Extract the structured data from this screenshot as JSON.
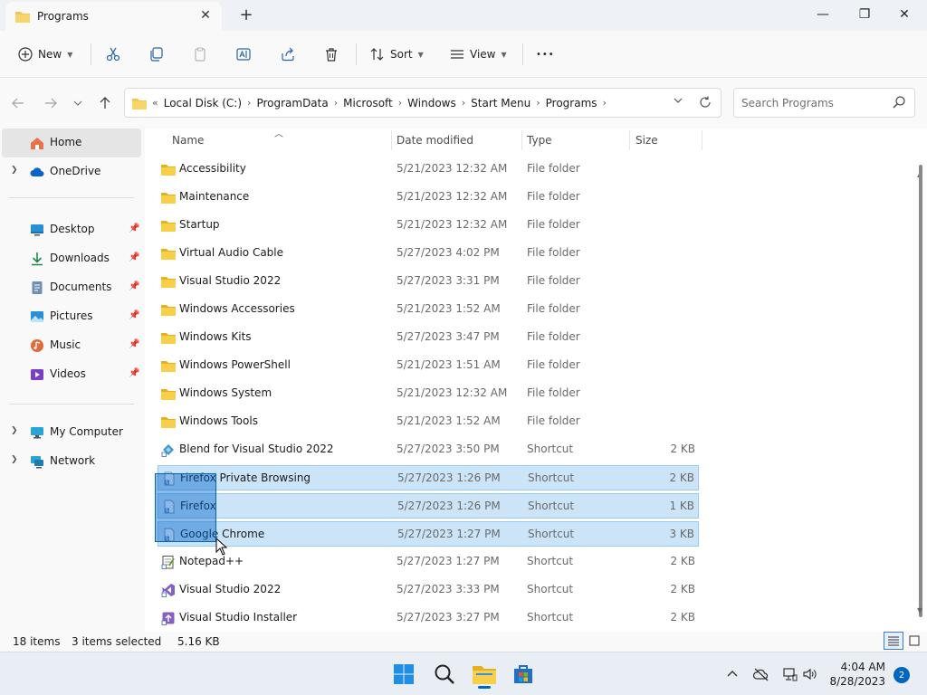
{
  "window": {
    "tab_title": "Programs",
    "new_tab_symbol": "+",
    "close_tab_symbol": "✕",
    "minimize_symbol": "—",
    "maximize_symbol": "❐",
    "close_symbol": "✕"
  },
  "toolbar": {
    "new_label": "New",
    "sort_label": "Sort",
    "view_label": "View",
    "more_symbol": "•••"
  },
  "address": {
    "overflow_symbol": "«",
    "crumbs": [
      "Local Disk (C:)",
      "ProgramData",
      "Microsoft",
      "Windows",
      "Start Menu",
      "Programs"
    ],
    "search_placeholder": "Search Programs"
  },
  "sidebar": {
    "items": [
      {
        "label": "Home",
        "icon": "home-icon"
      },
      {
        "label": "OneDrive",
        "icon": "cloud-icon"
      },
      {
        "label": "Desktop",
        "icon": "desktop-icon"
      },
      {
        "label": "Downloads",
        "icon": "download-icon"
      },
      {
        "label": "Documents",
        "icon": "document-icon"
      },
      {
        "label": "Pictures",
        "icon": "pictures-icon"
      },
      {
        "label": "Music",
        "icon": "music-icon"
      },
      {
        "label": "Videos",
        "icon": "video-icon"
      },
      {
        "label": "My Computer",
        "icon": "computer-icon"
      },
      {
        "label": "Network",
        "icon": "network-icon"
      }
    ]
  },
  "columns": {
    "name": "Name",
    "date": "Date modified",
    "type": "Type",
    "size": "Size"
  },
  "files": [
    {
      "name": "Accessibility",
      "date": "5/21/2023 12:32 AM",
      "type": "File folder",
      "size": "",
      "icon": "folder-icon",
      "selected": false
    },
    {
      "name": "Maintenance",
      "date": "5/21/2023 12:32 AM",
      "type": "File folder",
      "size": "",
      "icon": "folder-icon",
      "selected": false
    },
    {
      "name": "Startup",
      "date": "5/21/2023 12:32 AM",
      "type": "File folder",
      "size": "",
      "icon": "folder-icon",
      "selected": false
    },
    {
      "name": "Virtual Audio Cable",
      "date": "5/27/2023 4:02 PM",
      "type": "File folder",
      "size": "",
      "icon": "folder-icon",
      "selected": false
    },
    {
      "name": "Visual Studio 2022",
      "date": "5/27/2023 3:31 PM",
      "type": "File folder",
      "size": "",
      "icon": "folder-icon",
      "selected": false
    },
    {
      "name": "Windows Accessories",
      "date": "5/21/2023 1:52 AM",
      "type": "File folder",
      "size": "",
      "icon": "folder-icon",
      "selected": false
    },
    {
      "name": "Windows Kits",
      "date": "5/27/2023 3:47 PM",
      "type": "File folder",
      "size": "",
      "icon": "folder-icon",
      "selected": false
    },
    {
      "name": "Windows PowerShell",
      "date": "5/21/2023 1:51 AM",
      "type": "File folder",
      "size": "",
      "icon": "folder-icon",
      "selected": false
    },
    {
      "name": "Windows System",
      "date": "5/21/2023 12:32 AM",
      "type": "File folder",
      "size": "",
      "icon": "folder-icon",
      "selected": false
    },
    {
      "name": "Windows Tools",
      "date": "5/21/2023 1:52 AM",
      "type": "File folder",
      "size": "",
      "icon": "folder-icon",
      "selected": false
    },
    {
      "name": "Blend for Visual Studio 2022",
      "date": "5/27/2023 3:50 PM",
      "type": "Shortcut",
      "size": "2 KB",
      "icon": "blend-shortcut-icon",
      "selected": false
    },
    {
      "name": "Firefox Private Browsing",
      "date": "5/27/2023 1:26 PM",
      "type": "Shortcut",
      "size": "2 KB",
      "icon": "shortcut-icon",
      "selected": true
    },
    {
      "name": "Firefox",
      "date": "5/27/2023 1:26 PM",
      "type": "Shortcut",
      "size": "1 KB",
      "icon": "shortcut-icon",
      "selected": true
    },
    {
      "name": "Google Chrome",
      "date": "5/27/2023 1:27 PM",
      "type": "Shortcut",
      "size": "3 KB",
      "icon": "shortcut-icon",
      "selected": true
    },
    {
      "name": "Notepad++",
      "date": "5/27/2023 1:27 PM",
      "type": "Shortcut",
      "size": "2 KB",
      "icon": "notepad-shortcut-icon",
      "selected": false
    },
    {
      "name": "Visual Studio 2022",
      "date": "5/27/2023 3:33 PM",
      "type": "Shortcut",
      "size": "2 KB",
      "icon": "visual-studio-shortcut-icon",
      "selected": false
    },
    {
      "name": "Visual Studio Installer",
      "date": "5/27/2023 3:27 PM",
      "type": "Shortcut",
      "size": "2 KB",
      "icon": "visual-studio-installer-icon",
      "selected": false
    }
  ],
  "status": {
    "item_count": "18 items",
    "selected": "3 items selected",
    "selected_size": "5.16 KB"
  },
  "taskbar": {
    "time": "4:04 AM",
    "date": "8/28/2023",
    "notification_count": "2"
  },
  "colors": {
    "accent": "#0067c0",
    "selection": "#cce4f7",
    "folder": "#f4c550"
  }
}
